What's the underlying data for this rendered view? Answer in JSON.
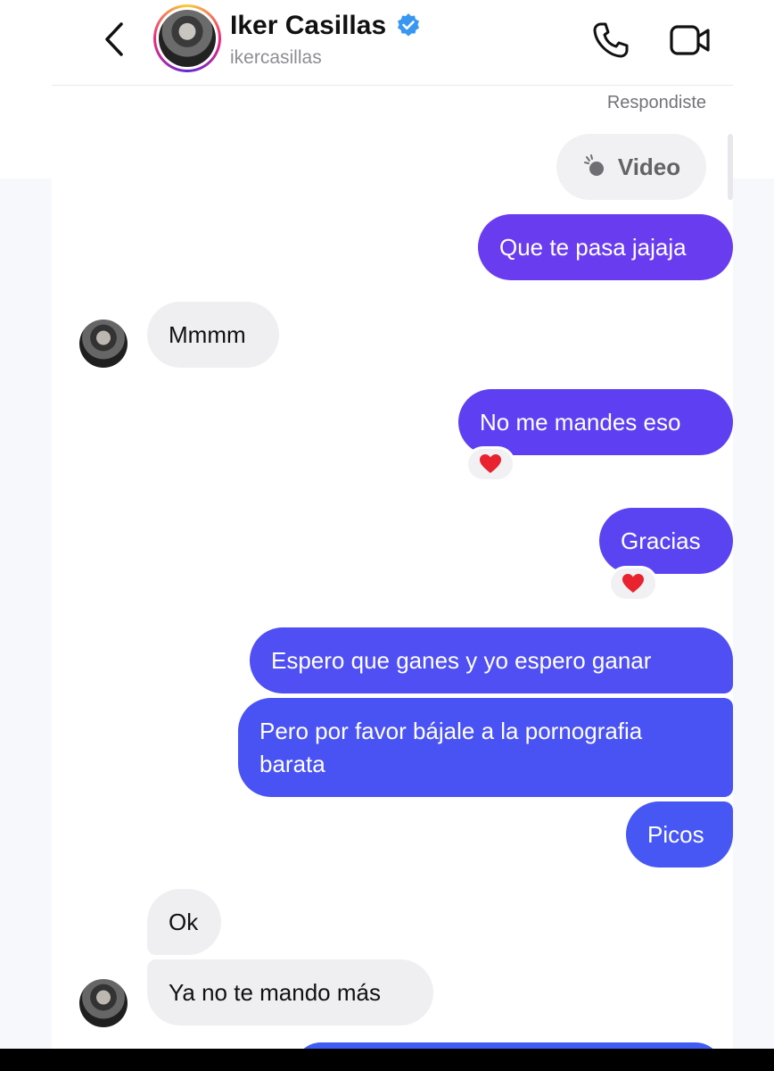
{
  "header": {
    "name": "Iker Casillas",
    "handle": "ikercasillas",
    "verified": true,
    "back_icon": "chevron-left-icon",
    "call_icon": "phone-icon",
    "video_icon": "video-camera-icon"
  },
  "thread": {
    "replied_label": "Respondiste",
    "replied_attachment": "Video",
    "messages": [
      {
        "from": "me",
        "text": "Que te pasa jajaja"
      },
      {
        "from": "contact",
        "text": "Mmmm"
      },
      {
        "from": "me",
        "text": "No me mandes eso",
        "reaction": "❤️"
      },
      {
        "from": "me",
        "text": "Gracias",
        "reaction": "❤️"
      },
      {
        "from": "me",
        "text": "Espero que ganes y yo espero ganar"
      },
      {
        "from": "me",
        "lines": [
          "Pero por favor bájale a la pornografia",
          "barata"
        ]
      },
      {
        "from": "me",
        "text": "Picos"
      },
      {
        "from": "contact",
        "text": "Ok"
      },
      {
        "from": "contact",
        "text": "Ya no te mando más"
      }
    ]
  },
  "colors": {
    "outgoing_start": "#6a3cf0",
    "outgoing_end": "#4657f3",
    "incoming": "#efeff2",
    "verified_blue": "#3897f0"
  }
}
